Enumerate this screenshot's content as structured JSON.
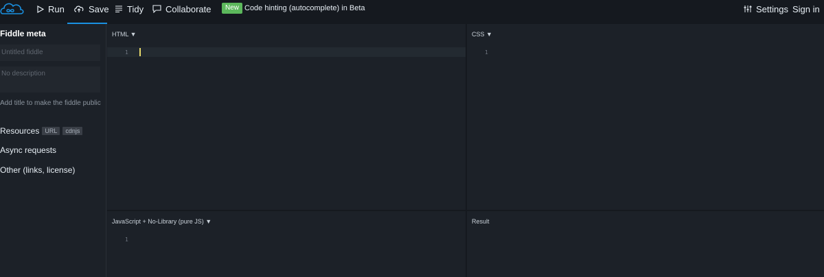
{
  "toolbar": {
    "run_label": "Run",
    "save_label": "Save",
    "tidy_label": "Tidy",
    "collaborate_label": "Collaborate",
    "new_badge": "New",
    "notice": "Code hinting (autocomplete) in Beta",
    "settings_label": "Settings",
    "signin_label": "Sign in"
  },
  "sidebar": {
    "heading": "Fiddle meta",
    "title_placeholder": "Untitled fiddle",
    "description_placeholder": "No description",
    "hint": "Add title to make the fiddle public",
    "resources_label": "Resources",
    "resource_tags": [
      "URL",
      "cdnjs"
    ],
    "async_label": "Async requests",
    "other_label": "Other (links, license)"
  },
  "panels": {
    "html": {
      "label": "HTML ▼",
      "line_number": "1"
    },
    "css": {
      "label": "CSS ▼",
      "line_number": "1"
    },
    "js": {
      "label": "JavaScript + No-Library (pure JS) ▼",
      "line_number": "1"
    },
    "result": {
      "label": "Result"
    }
  },
  "colors": {
    "accent": "#1a91e2",
    "new_badge": "#5cb85c",
    "cursor": "#e7d96a"
  }
}
